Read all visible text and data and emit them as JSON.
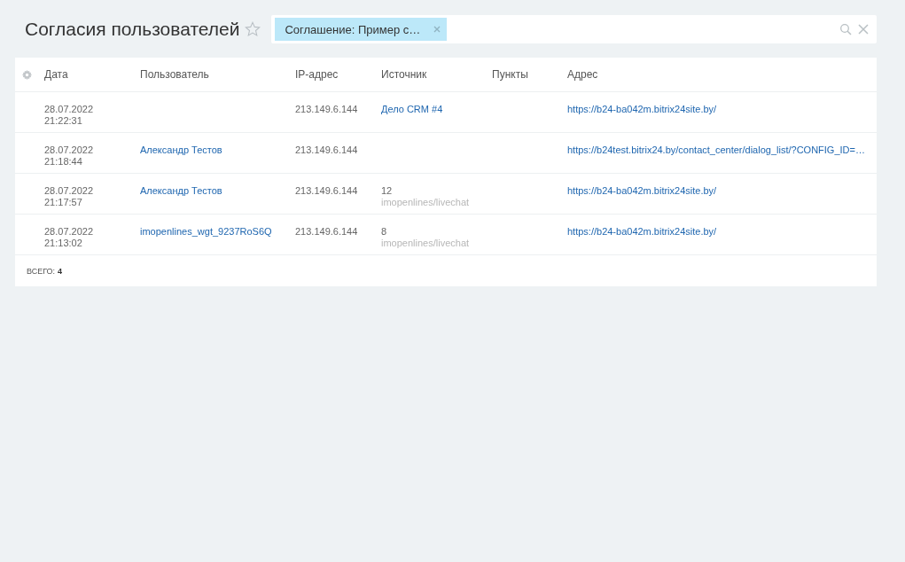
{
  "title": "Согласия пользователей",
  "filter": {
    "tag": "Соглашение: Пример с…"
  },
  "table": {
    "columns": [
      "Дата",
      "Пользователь",
      "IP-адрес",
      "Источник",
      "Пункты",
      "Адрес"
    ],
    "rows": [
      {
        "date": "28.07.2022",
        "time": "21:22:31",
        "user": "",
        "ip": "213.149.6.144",
        "source": {
          "kind": "link",
          "text": "Дело CRM #4"
        },
        "address": "https://b24-ba042m.bitrix24site.by/"
      },
      {
        "date": "28.07.2022",
        "time": "21:18:44",
        "user": "Александр Тестов",
        "ip": "213.149.6.144",
        "source": {
          "kind": "none"
        },
        "address": "https://b24test.bitrix24.by/contact_center/dialog_list/?CONFIG_ID=…"
      },
      {
        "date": "28.07.2022",
        "time": "21:17:57",
        "user": "Александр Тестов",
        "ip": "213.149.6.144",
        "source": {
          "kind": "text",
          "text": "12",
          "note": "imopenlines/livechat"
        },
        "address": "https://b24-ba042m.bitrix24site.by/"
      },
      {
        "date": "28.07.2022",
        "time": "21:13:02",
        "user": "imopenlines_wgt_9237RoS6Q",
        "ip": "213.149.6.144",
        "source": {
          "kind": "text",
          "text": "8",
          "note": "imopenlines/livechat"
        },
        "address": "https://b24-ba042m.bitrix24site.by/"
      }
    ],
    "total_label": "ВСЕГО:",
    "total": "4"
  }
}
